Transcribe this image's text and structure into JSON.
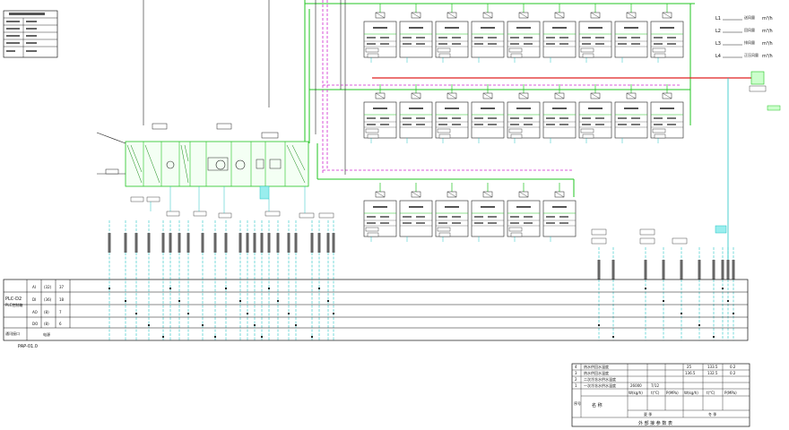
{
  "info_box": {
    "title": "",
    "rows": [
      "",
      "",
      "",
      "",
      ""
    ]
  },
  "plc": {
    "cabinet_label": "PLC-D2",
    "cabinet_label2": "PLC控制箱",
    "comm_label": "通讯接口",
    "power_label": "电源",
    "panel_label": "PAP-01.0",
    "io_rows": [
      {
        "type": "AI",
        "code": "(32)",
        "count": "37"
      },
      {
        "type": "DI",
        "code": "(36)",
        "count": "18"
      },
      {
        "type": "AO",
        "code": "(8)",
        "count": "7"
      },
      {
        "type": "DO",
        "code": "(8)",
        "count": "6"
      }
    ]
  },
  "flow_panel": {
    "rows": [
      {
        "code": "L1",
        "name": "送风量",
        "unit": "m³/h"
      },
      {
        "code": "L2",
        "name": "回风量",
        "unit": "m³/h"
      },
      {
        "code": "L3",
        "name": "排风量",
        "unit": "m³/h"
      },
      {
        "code": "L4",
        "name": "正压风量",
        "unit": "m³/h"
      }
    ]
  },
  "param_table": {
    "rows": [
      {
        "no": "4",
        "name": "热水供回水温度",
        "v1": "",
        "v2": "",
        "v3": "25",
        "v4": "133.5",
        "v5": "0.2"
      },
      {
        "no": "3",
        "name": "热水供回水温度",
        "v1": "",
        "v2": "",
        "v3": "136.5",
        "v4": "132.5",
        "v5": "0.2"
      },
      {
        "no": "2",
        "name": "二次冷冻水供水温度",
        "v1": "",
        "v2": "",
        "v3": "",
        "v4": "",
        "v5": ""
      },
      {
        "no": "1",
        "name": "一次冷冻水供水温度",
        "v1": "26000",
        "v2": "7/12",
        "v3": "",
        "v4": "",
        "v5": ""
      }
    ],
    "col_units": [
      "W(kg/h)",
      "t(°C)",
      "P(MPa)",
      "W(kg/h)",
      "t(°C)",
      "P(MPa)"
    ],
    "header_no": "序号",
    "header_name": "名  称",
    "header_summer": "夏  季",
    "header_winter": "冬  季",
    "footer": "外 部 接 参 数 表"
  }
}
